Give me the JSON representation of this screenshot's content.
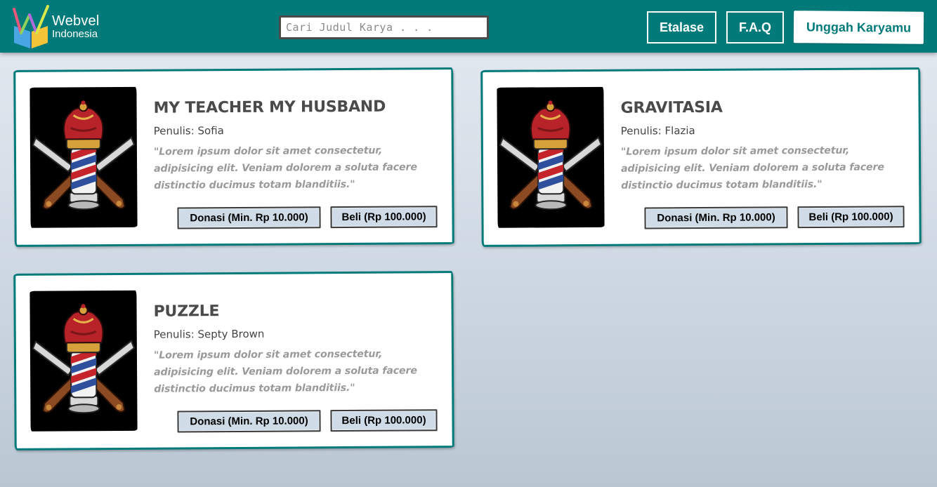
{
  "header": {
    "logo_line1": "Webvel",
    "logo_line2": "Indonesia",
    "search_placeholder": "Cari Judul Karya . . .",
    "nav": {
      "etalase": "Etalase",
      "faq": "F.A.Q",
      "upload": "Unggah Karyamu"
    }
  },
  "colors": {
    "brand_teal": "#027a7a",
    "button_bg": "#cfdbe6"
  },
  "cover_icon": "barber-pole-crown-icon",
  "books": [
    {
      "title": "MY TEACHER MY HUSBAND",
      "author": "Penulis: Sofia",
      "synopsis": "\"Lorem ipsum dolor sit amet consectetur, adipisicing elit. Veniam dolorem a soluta facere distinctio ducimus totam blanditiis.\"",
      "donate_label": "Donasi (Min. Rp 10.000)",
      "buy_label": "Beli (Rp 100.000)"
    },
    {
      "title": "GRAVITASIA",
      "author": "Penulis: Flazia",
      "synopsis": "\"Lorem ipsum dolor sit amet consectetur, adipisicing elit. Veniam dolorem a soluta facere distinctio ducimus totam blanditiis.\"",
      "donate_label": "Donasi (Min. Rp 10.000)",
      "buy_label": "Beli (Rp 100.000)"
    },
    {
      "title": "PUZZLE",
      "author": "Penulis: Septy Brown",
      "synopsis": "\"Lorem ipsum dolor sit amet consectetur, adipisicing elit. Veniam dolorem a soluta facere distinctio ducimus totam blanditiis.\"",
      "donate_label": "Donasi (Min. Rp 10.000)",
      "buy_label": "Beli (Rp 100.000)"
    }
  ]
}
